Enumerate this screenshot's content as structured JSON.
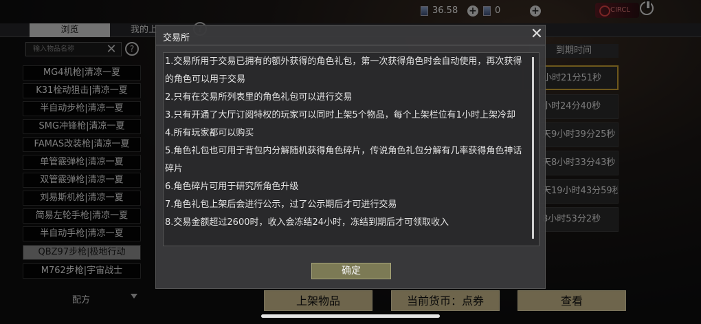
{
  "topbar": {
    "currency1": "36.58",
    "currency2": "0",
    "brand": "CIRCL"
  },
  "tabs": {
    "browse": "浏览",
    "mine": "我的上"
  },
  "search": {
    "placeholder": "输入物品名称"
  },
  "left_list": [
    "MG4机枪|清凉一夏",
    "K31栓动狙击|清凉一夏",
    "半自动步枪|清凉一夏",
    "SMG冲锋枪|清凉一夏",
    "FAMAS改装枪|清凉一夏",
    "单管霰弹枪|清凉一夏",
    "双管霰弹枪|清凉一夏",
    "刘易斯机枪|清凉一夏",
    "简易左轮手枪|清凉一夏",
    "半自动手枪|清凉一夏",
    "QBZ97步枪|极地行动",
    "M762步枪|宇宙战士"
  ],
  "recipe_label": "配方",
  "right": {
    "expire_header": "到期时间",
    "rows": [
      "小时21分51秒",
      "小时24分40秒",
      "天9小时39分25秒",
      "天8小时33分43秒",
      "天19小时43分59秒",
      "8小时53分2秒"
    ]
  },
  "bottom_buttons": {
    "list_item": "上架物品",
    "currency": "当前货币：点券",
    "view": "查看"
  },
  "dialog": {
    "title": "交易所",
    "rules": [
      "1.交易所用于交易已拥有的额外获得的角色礼包，第一次获得角色时会自动使用，再次获得",
      "的角色可以用于交易",
      "2.只有在交易所列表里的角色礼包可以进行交易",
      "3.只有开通了大厅订阅特权的玩家可以同时上架5个物品，每个上架栏位有1小时上架冷却",
      "4.所有玩家都可以购买",
      "5.角色礼包也可用于背包内分解随机获得角色碎片，传说角色礼包分解有几率获得角色神话",
      "碎片",
      "6.角色碎片可用于研究所角色升级",
      "7.角色礼包上架后会进行公示，过了公示期后才可进行交易",
      "8.交易金额超过2600时，收入会冻结24小时，冻结到期后才可领取收入"
    ],
    "confirm": "确定"
  }
}
